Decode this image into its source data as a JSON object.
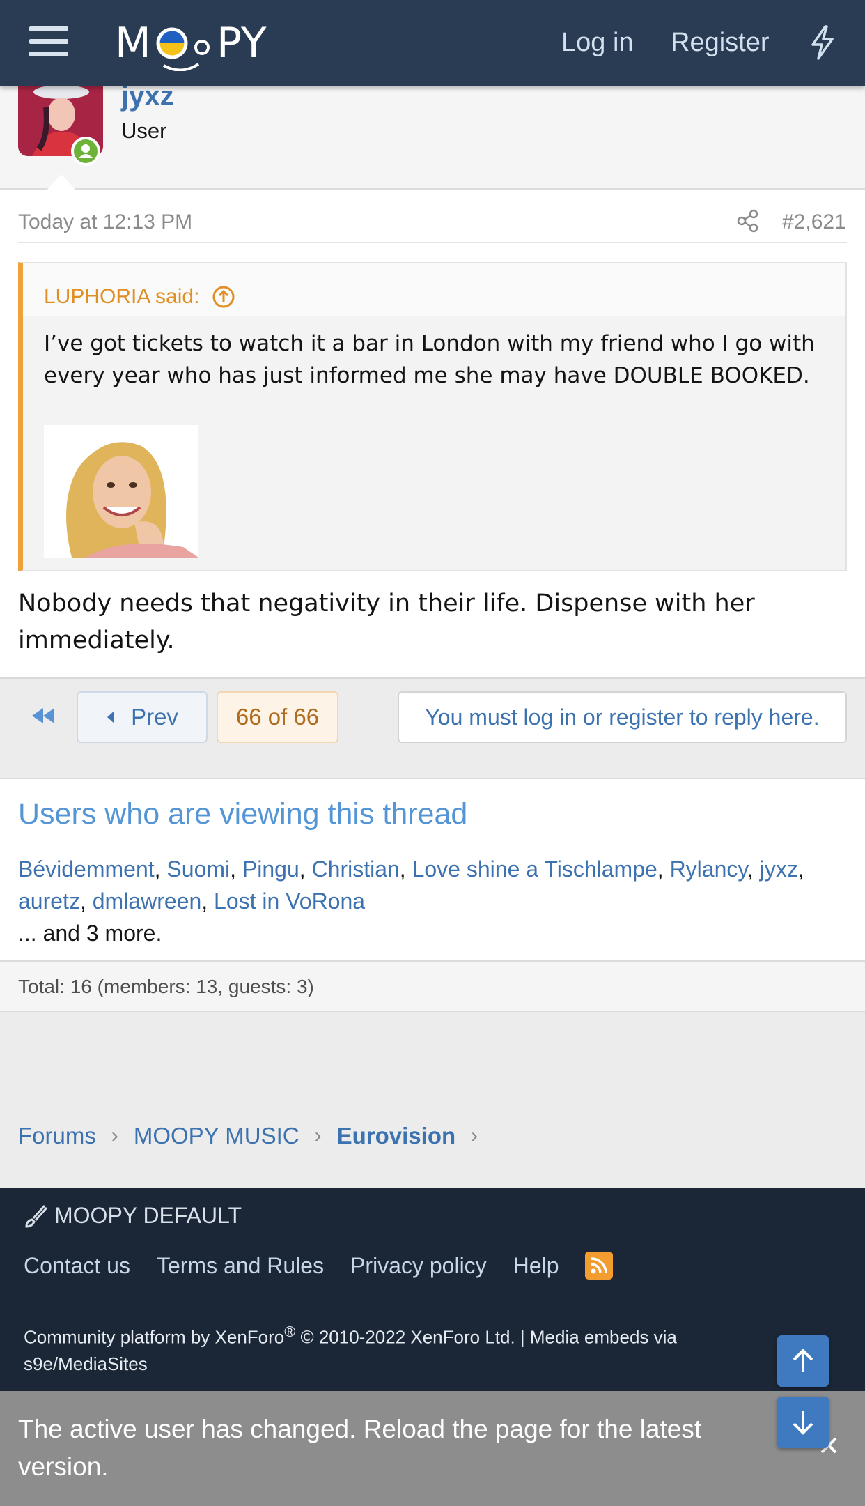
{
  "header": {
    "logo": "MOOPY",
    "login_label": "Log in",
    "register_label": "Register"
  },
  "author": {
    "name": "jyxz",
    "title": "User"
  },
  "post": {
    "date": "Today at 12:13 PM",
    "number": "#2,621",
    "quote": {
      "attribution": "LUPHORIA said:",
      "text": "I’ve got tickets to watch it a bar in London with my friend who I go with every year who has just informed me she may have DOUBLE BOOKED."
    },
    "body": "Nobody needs that negativity in their life. Dispense with her immediately."
  },
  "pagination": {
    "prev_label": "Prev",
    "page_indicator": "66 of 66",
    "reply_label": "You must log in or register to reply here."
  },
  "viewers": {
    "title": "Users who are viewing this thread",
    "users": [
      "Bévidemment",
      "Suomi",
      "Pingu",
      "Christian",
      "Love shine a Tischlampe",
      "Rylancy",
      "jyxz",
      "auretz",
      "dmlawreen",
      "Lost in VoRona"
    ],
    "more": "... and 3 more.",
    "total": "Total: 16 (members: 13, guests: 3)"
  },
  "breadcrumb": [
    "Forums",
    "MOOPY MUSIC",
    "Eurovision"
  ],
  "footer": {
    "style_label": "MOOPY DEFAULT",
    "links": [
      "Contact us",
      "Terms and Rules",
      "Privacy policy",
      "Help"
    ],
    "copyright_prefix": "Community platform by XenForo",
    "copyright_suffix": " © 2010-2022 XenForo Ltd. | Media embeds via s9e/MediaSites"
  },
  "notice": {
    "text": "The active user has changed. Reload the page for the latest version."
  },
  "colors": {
    "header_bg": "#2a3c54",
    "link": "#3d72b0",
    "quote_accent": "#f0a23a",
    "footer_bg": "#1b2637",
    "online": "#6fb23a"
  }
}
